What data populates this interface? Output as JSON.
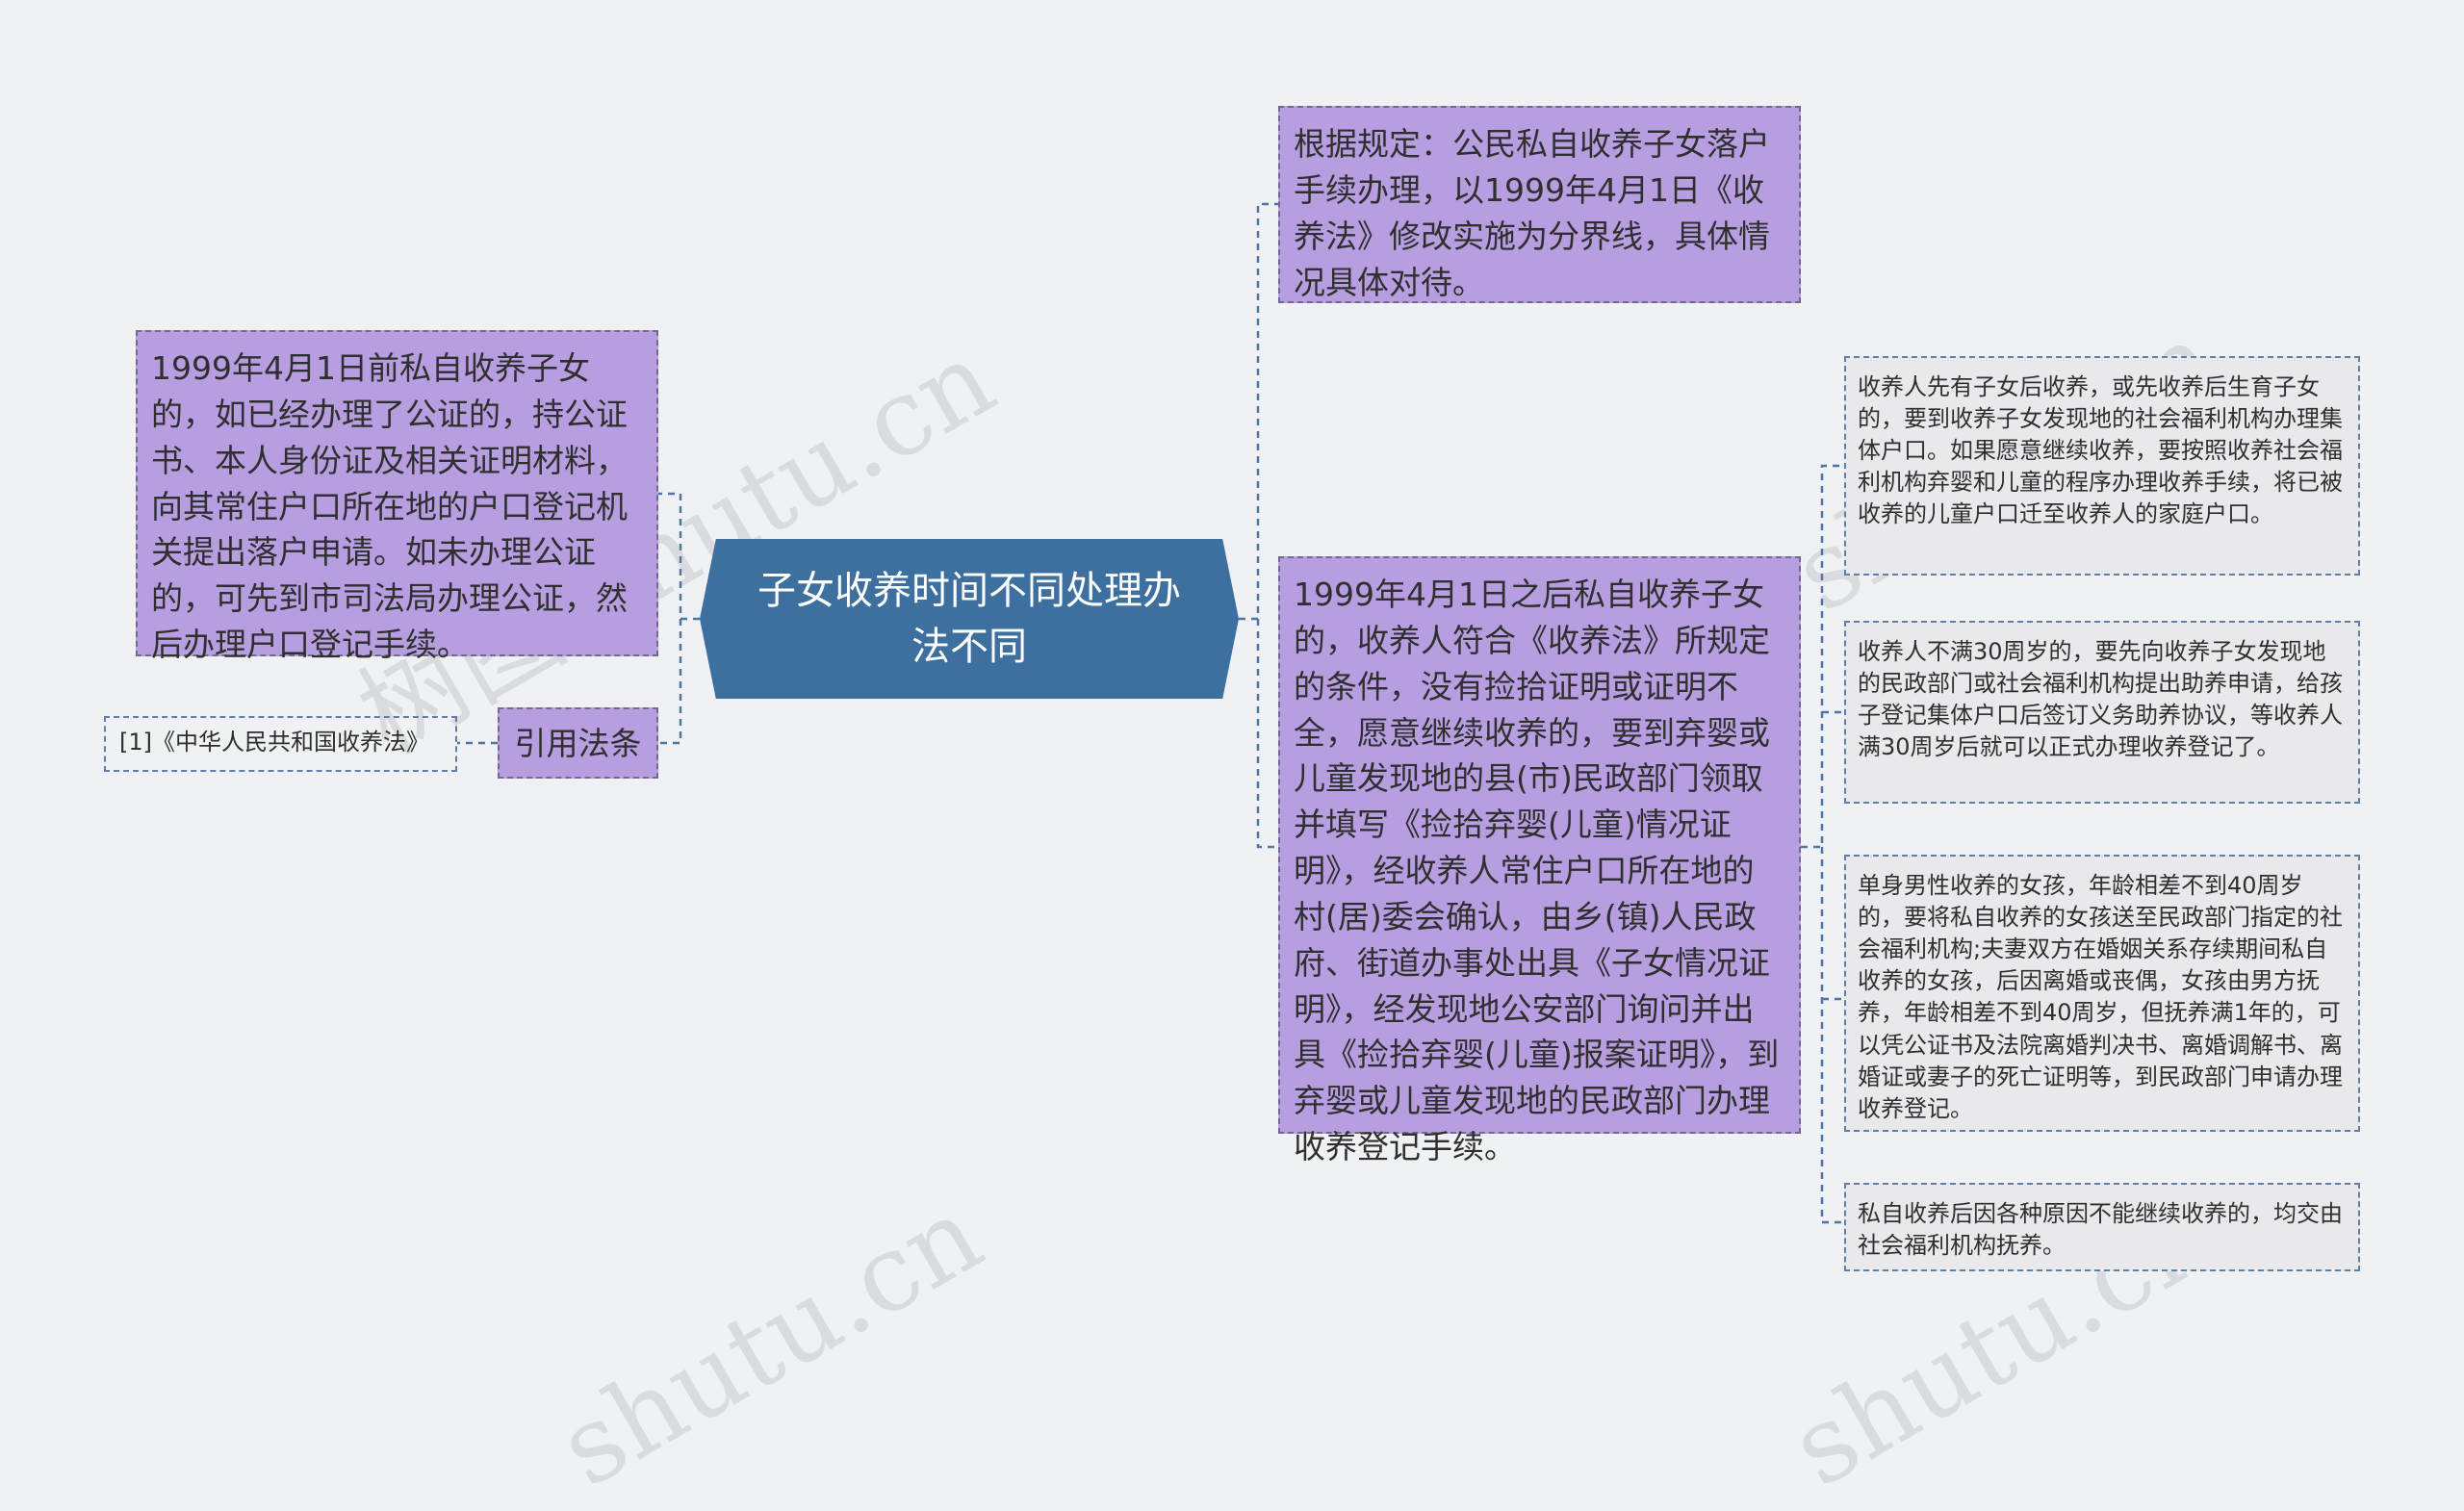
{
  "central_topic": "子女收养时间不同处理办法不同",
  "left": {
    "before_1999": "1999年4月1日前私自收养子女的，如已经办理了公证的，持公证书、本人身份证及相关证明材料，向其常住户口所在地的户口登记机关提出落户申请。如未办理公证的，可先到市司法局办理公证，然后办理户口登记手续。",
    "law_label": "引用法条",
    "law_ref": "[1]《中华人民共和国收养法》"
  },
  "right": {
    "rule": "根据规定：公民私自收养子女落户手续办理，以1999年4月1日《收养法》修改实施为分界线，具体情况具体对待。",
    "after_1999": "1999年4月1日之后私自收养子女的，收养人符合《收养法》所规定的条件，没有捡拾证明或证明不全，愿意继续收养的，要到弃婴或儿童发现地的县(市)民政部门领取并填写《捡拾弃婴(儿童)情况证明》，经收养人常住户口所在地的村(居)委会确认，由乡(镇)人民政府、街道办事处出具《子女情况证明》，经发现地公安部门询问并出具《捡拾弃婴(儿童)报案证明》，到弃婴或儿童发现地的民政部门办理收养登记手续。",
    "details": [
      "收养人先有子女后收养，或先收养后生育子女的，要到收养子女发现地的社会福利机构办理集体户口。如果愿意继续收养，要按照收养社会福利机构弃婴和儿童的程序办理收养手续，将已被收养的儿童户口迁至收养人的家庭户口。",
      "收养人不满30周岁的，要先向收养子女发现地的民政部门或社会福利机构提出助养申请，给孩子登记集体户口后签订义务助养协议，等收养人满30周岁后就可以正式办理收养登记了。",
      "单身男性收养的女孩，年龄相差不到40周岁的，要将私自收养的女孩送至民政部门指定的社会福利机构;夫妻双方在婚姻关系存续期间私自收养的女孩，后因离婚或丧偶，女孩由男方抚养，年龄相差不到40周岁，但抚养满1年的，可以凭公证书及法院离婚判决书、离婚调解书、离婚证或妻子的死亡证明等，到民政部门申请办理收养登记。",
      "私自收养后因各种原因不能继续收养的，均交由社会福利机构抚养。"
    ]
  },
  "watermarks": [
    "树图 shutu.cn",
    "树图 shutu.cn",
    "shutu.cn",
    "shutu.cn"
  ],
  "colors": {
    "central": "#3d6f9f",
    "purple_node": "#b79ee0",
    "gray_node": "#e9e9ec",
    "connector": "#4f76a3",
    "background": "#eff1f4"
  }
}
